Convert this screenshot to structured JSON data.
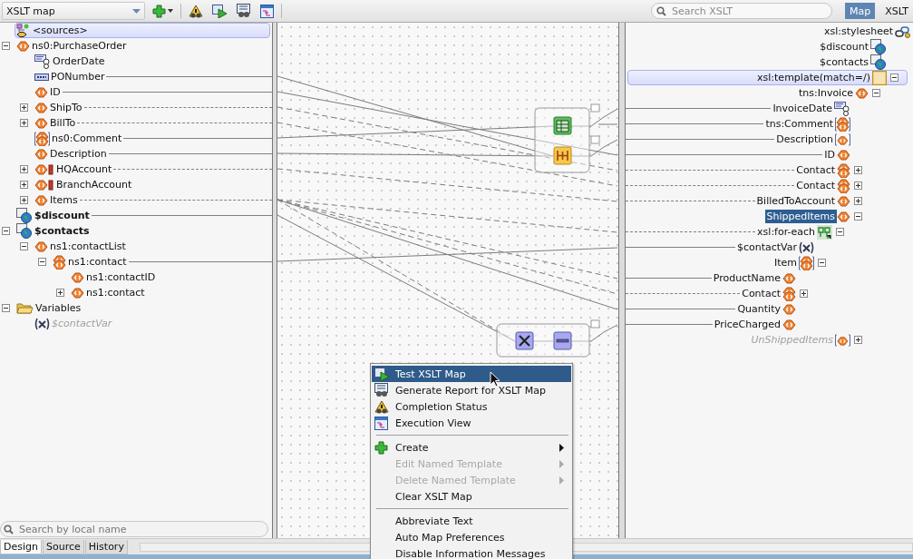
{
  "toolbar": {
    "map_selector": "XSLT map",
    "search": {
      "placeholder": "Search XSLT"
    },
    "view_tabs": [
      {
        "label": "Map",
        "selected": true
      },
      {
        "label": "XSLT",
        "selected": false
      }
    ]
  },
  "source_tree": [
    {
      "label": "<sources>",
      "kind": "sources",
      "selected": false
    },
    {
      "label": "ns0:PurchaseOrder",
      "kind": "element",
      "selected": false,
      "expanded": true,
      "children": [
        {
          "label": "OrderDate",
          "kind": "date",
          "selected": false
        },
        {
          "label": "PONumber",
          "kind": "text",
          "selected": false,
          "mapped": true,
          "dashed": false
        },
        {
          "label": "ID",
          "kind": "element",
          "selected": false,
          "mapped": true,
          "dashed": false
        },
        {
          "label": "ShipTo",
          "kind": "element",
          "selected": false,
          "expanded": false,
          "mapped": true,
          "dashed": true
        },
        {
          "label": "BillTo",
          "kind": "element",
          "selected": false,
          "expanded": false,
          "mapped": true,
          "dashed": true
        },
        {
          "label": "ns0:Comment",
          "kind": "comment",
          "selected": false,
          "mapped": true,
          "dashed": false
        },
        {
          "label": "Description",
          "kind": "element",
          "selected": false,
          "mapped": true,
          "dashed": false
        },
        {
          "label": "HQAccount",
          "kind": "choice",
          "selected": false,
          "expanded": false,
          "mapped": true,
          "dashed": true
        },
        {
          "label": "BranchAccount",
          "kind": "choice",
          "selected": false,
          "expanded": false
        },
        {
          "label": "Items",
          "kind": "element",
          "selected": false,
          "expanded": false,
          "mapped": true,
          "dashed": true
        }
      ]
    },
    {
      "label": "$discount",
      "kind": "param",
      "selected": false,
      "mapped": true,
      "dashed": false
    },
    {
      "label": "$contacts",
      "kind": "param",
      "selected": false,
      "expanded": true,
      "children": [
        {
          "label": "ns1:contactList",
          "kind": "element",
          "selected": false,
          "expanded": true,
          "children": [
            {
              "label": "ns1:contact",
              "kind": "repeating",
              "selected": false,
              "expanded": true,
              "mapped": true,
              "dashed": false,
              "children": [
                {
                  "label": "ns1:contactID",
                  "kind": "element",
                  "selected": false
                },
                {
                  "label": "ns1:contact",
                  "kind": "element",
                  "selected": false,
                  "expanded": false
                }
              ]
            }
          ]
        }
      ]
    },
    {
      "label": "Variables",
      "kind": "folder",
      "selected": false,
      "expanded": true,
      "children": [
        {
          "label": "$contactVar",
          "kind": "variable",
          "selected": false,
          "disabled": true
        }
      ]
    }
  ],
  "target_tree": [
    {
      "label": "xsl:stylesheet",
      "kind": "stylesheet",
      "selected": false,
      "children": [
        {
          "label": "$discount",
          "kind": "param",
          "selected": false
        },
        {
          "label": "$contacts",
          "kind": "param",
          "selected": false
        },
        {
          "label": "xsl:template(match=/)",
          "kind": "template",
          "selected": false,
          "expanded": true,
          "children": [
            {
              "label": "tns:Invoice",
              "kind": "element",
              "selected": false,
              "expanded": true,
              "children": [
                {
                  "label": "InvoiceDate",
                  "kind": "date",
                  "selected": false,
                  "mapped": true,
                  "dashed": false
                },
                {
                  "label": "tns:Comment",
                  "kind": "comment",
                  "selected": false,
                  "mapped": true,
                  "dashed": false
                },
                {
                  "label": "Description",
                  "kind": "optional",
                  "selected": false,
                  "mapped": true,
                  "dashed": false
                },
                {
                  "label": "ID",
                  "kind": "element",
                  "selected": false,
                  "mapped": true,
                  "dashed": false
                },
                {
                  "label": "Contact",
                  "kind": "repeating",
                  "selected": false,
                  "expanded": false,
                  "mapped": true,
                  "dashed": true
                },
                {
                  "label": "Contact",
                  "kind": "repeating",
                  "selected": false,
                  "expanded": false,
                  "mapped": true,
                  "dashed": true
                },
                {
                  "label": "BilledToAccount",
                  "kind": "element",
                  "selected": false,
                  "expanded": false,
                  "mapped": true,
                  "dashed": true
                },
                {
                  "label": "ShippedItems",
                  "kind": "element",
                  "selected": true,
                  "expanded": true,
                  "children": [
                    {
                      "label": "xsl:for-each",
                      "kind": "foreach",
                      "selected": false,
                      "expanded": true,
                      "mapped": true,
                      "dashed": true,
                      "children": [
                        {
                          "label": "$contactVar",
                          "kind": "variable",
                          "selected": false,
                          "mapped": true,
                          "dashed": false
                        },
                        {
                          "label": "Item",
                          "kind": "comment",
                          "selected": false,
                          "expanded": true,
                          "children": [
                            {
                              "label": "ProductName",
                              "kind": "element",
                              "selected": false,
                              "mapped": true,
                              "dashed": false
                            },
                            {
                              "label": "Contact",
                              "kind": "repeating",
                              "selected": false,
                              "expanded": false,
                              "mapped": true,
                              "dashed": true
                            },
                            {
                              "label": "Quantity",
                              "kind": "element",
                              "selected": false,
                              "mapped": true,
                              "dashed": false
                            },
                            {
                              "label": "PriceCharged",
                              "kind": "element",
                              "selected": false,
                              "mapped": true,
                              "dashed": false
                            }
                          ]
                        }
                      ]
                    }
                  ]
                },
                {
                  "label": "UnShippedItems",
                  "kind": "optional",
                  "selected": false,
                  "expanded": false,
                  "disabled": true
                }
              ]
            }
          ]
        }
      ]
    }
  ],
  "bottom": {
    "search": {
      "placeholder": "Search by local name"
    },
    "editor_tabs": [
      {
        "label": "Design",
        "selected": true
      },
      {
        "label": "Source",
        "selected": false
      },
      {
        "label": "History",
        "selected": false
      }
    ]
  },
  "context_menu": [
    {
      "kind": "test",
      "label": "Test XSLT Map",
      "selected": true,
      "disabled": false,
      "submenu": false
    },
    {
      "kind": "report",
      "label": "Generate Report for XSLT Map",
      "selected": false,
      "disabled": false,
      "submenu": false
    },
    {
      "kind": "status",
      "label": "Completion Status",
      "selected": false,
      "disabled": false,
      "submenu": false
    },
    {
      "kind": "view",
      "label": "Execution View",
      "selected": false,
      "disabled": false,
      "submenu": false
    },
    {
      "kind": "separator"
    },
    {
      "kind": "create",
      "label": "Create",
      "selected": false,
      "disabled": false,
      "submenu": true
    },
    {
      "kind": "plain",
      "label": "Edit Named Template",
      "selected": false,
      "disabled": true,
      "submenu": true
    },
    {
      "kind": "plain",
      "label": "Delete Named Template",
      "selected": false,
      "disabled": true,
      "submenu": true
    },
    {
      "kind": "plain",
      "label": "Clear XSLT Map",
      "selected": false,
      "disabled": false,
      "submenu": false
    },
    {
      "kind": "separator"
    },
    {
      "kind": "plain",
      "label": "Abbreviate Text",
      "selected": false,
      "disabled": false,
      "submenu": false
    },
    {
      "kind": "plain",
      "label": "Auto Map Preferences",
      "selected": false,
      "disabled": false,
      "submenu": false
    },
    {
      "kind": "plain",
      "label": "Disable Information Messages",
      "selected": false,
      "disabled": false,
      "submenu": false
    }
  ]
}
